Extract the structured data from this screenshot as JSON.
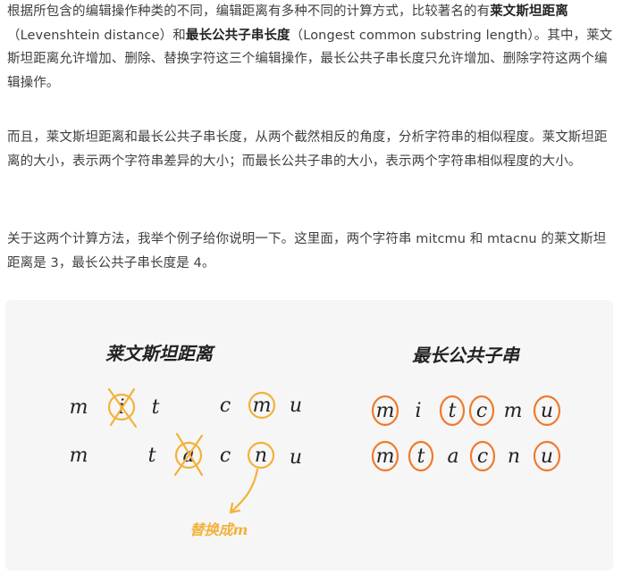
{
  "p1": {
    "a": "根据所包含的编辑操作种类的不同，编辑距离有多种不同的计算方式，比较著名的有",
    "term1": "莱文斯坦距离",
    "b": "（Levenshtein distance）和",
    "term2": "最长公共子串长度",
    "c": "（Longest common substring length）。其中，莱文斯坦距离允许增加、删除、替换字符这三个编辑操作，最长公共子串长度只允许增加、删除字符这两个编辑操作。"
  },
  "p2": "而且，莱文斯坦距离和最长公共子串长度，从两个截然相反的角度，分析字符串的相似程度。莱文斯坦距离的大小，表示两个字符串差异的大小；而最长公共子串的大小，表示两个字符串相似程度的大小。",
  "p3": "关于这两个计算方法，我举个例子给你说明一下。这里面，两个字符串 mitcmu 和 mtacnu 的莱文斯坦距离是 3，最长公共子串长度是 4。",
  "figure": {
    "left_title": "莱文斯坦距离",
    "right_title": "最长公共子串",
    "annotation": "替换成m",
    "left_row1": [
      "m",
      "i",
      "t",
      "c",
      "m",
      "u"
    ],
    "left_row2": [
      "m",
      "t",
      "a",
      "c",
      "n",
      "u"
    ],
    "right_row1": [
      "m",
      "i",
      "t",
      "c",
      "m",
      "u"
    ],
    "right_row2": [
      "m",
      "t",
      "a",
      "c",
      "n",
      "u"
    ],
    "colors": {
      "ink": "#222222",
      "yellow": "#f3b23a",
      "orange": "#f07a2c",
      "bg": "#f6f6f6"
    }
  }
}
